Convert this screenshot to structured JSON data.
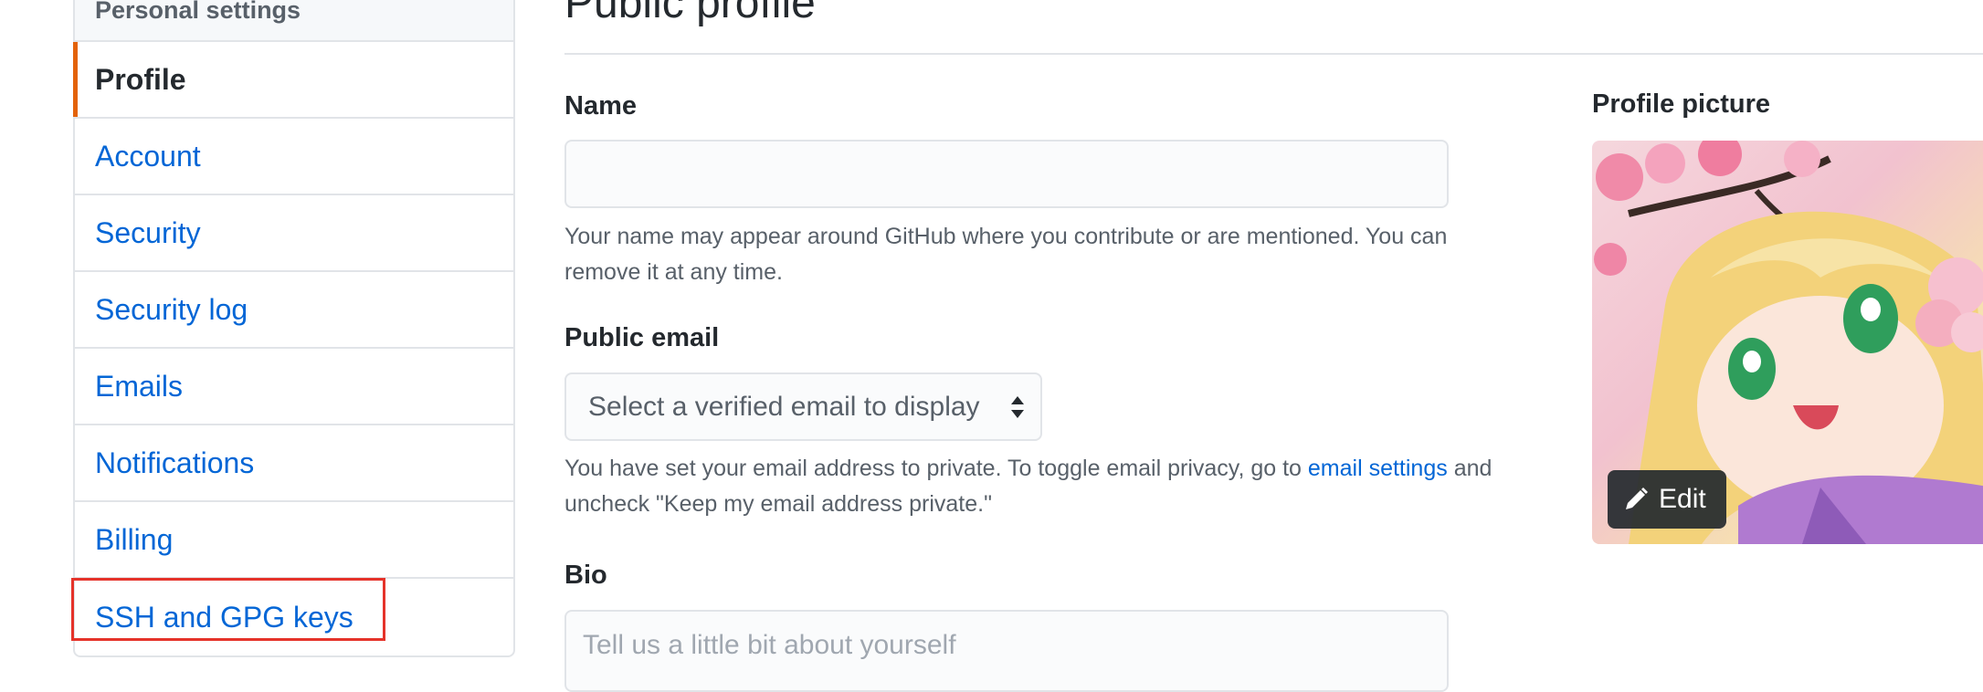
{
  "sidebar": {
    "heading": "Personal settings",
    "items": [
      {
        "label": "Profile"
      },
      {
        "label": "Account"
      },
      {
        "label": "Security"
      },
      {
        "label": "Security log"
      },
      {
        "label": "Emails"
      },
      {
        "label": "Notifications"
      },
      {
        "label": "Billing"
      },
      {
        "label": "SSH and GPG keys"
      }
    ],
    "selected": "Profile",
    "highlighted": "SSH and GPG keys",
    "accent_color": "#e36209",
    "highlight_color": "#e5332a"
  },
  "main": {
    "title": "Public profile",
    "name": {
      "label": "Name",
      "value": "",
      "note": "Your name may appear around GitHub where you contribute or are mentioned. You can remove it at any time."
    },
    "public_email": {
      "label": "Public email",
      "selected": "Select a verified email to display",
      "note_before": "You have set your email address to private. To toggle email privacy, go to",
      "note_link": "email settings",
      "note_after": "and uncheck \"Keep my email address private.\""
    },
    "bio": {
      "label": "Bio",
      "placeholder": "Tell us a little bit about yourself"
    }
  },
  "profile_picture": {
    "label": "Profile picture",
    "edit_label": "Edit",
    "edit_icon": "pencil-icon"
  },
  "colors": {
    "link": "#0366d6",
    "text": "#24292e",
    "muted": "#586069",
    "border": "#e1e4e8"
  }
}
